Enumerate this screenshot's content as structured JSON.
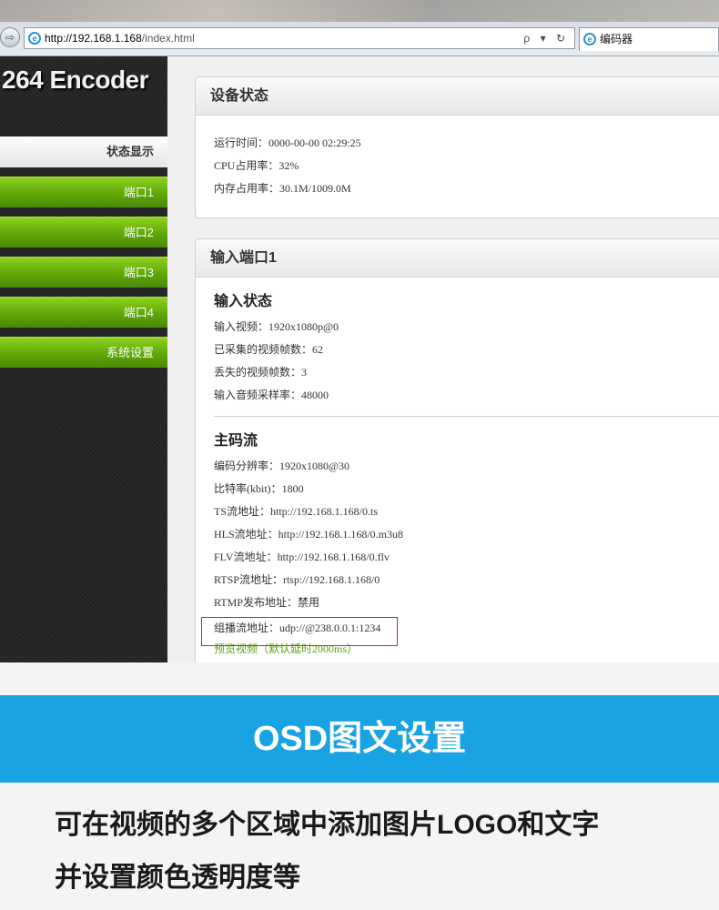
{
  "browser": {
    "url_host": "http://192.168.1.168",
    "url_path": "/index.html",
    "tab_title": "编码器",
    "ie_glyph": "e",
    "back_glyph": "⇨",
    "controls": "ρ ▾ ↻"
  },
  "sidebar": {
    "logo": "264 Encoder",
    "status_label": "状态显示",
    "items": [
      {
        "label": "端口1"
      },
      {
        "label": "端口2"
      },
      {
        "label": "端口3"
      },
      {
        "label": "端口4"
      },
      {
        "label": "系统设置"
      }
    ]
  },
  "device_status": {
    "title": "设备状态",
    "rows": [
      "运行时间：0000-00-00 02:29:25",
      "CPU占用率：32%",
      "内存占用率：30.1M/1009.0M"
    ]
  },
  "input_port": {
    "title": "输入端口1",
    "status_title": "输入状态",
    "status_rows": [
      "输入视频：1920x1080p@0",
      "已采集的视频帧数：62",
      "丢失的视频帧数：3",
      "输入音频采样率：48000"
    ],
    "stream_title": "主码流",
    "stream_rows": [
      "编码分辨率：1920x1080@30",
      "比特率(kbit)：1800",
      "TS流地址：http://192.168.1.168/0.ts",
      "HLS流地址：http://192.168.1.168/0.m3u8",
      "FLV流地址：http://192.168.1.168/0.flv",
      "RTSP流地址：rtsp://192.168.1.168/0",
      "RTMP发布地址：禁用",
      "组播流地址：udp://@238.0.0.1:1234"
    ],
    "preview_link": "预览视频（默认延时2000ms）"
  },
  "banner": {
    "title": "OSD图文设置",
    "bg_color": "#1aa3e2"
  },
  "description": {
    "line1": "可在视频的多个区域中添加图片LOGO和文字",
    "line2": "并设置颜色透明度等"
  },
  "icons": {
    "browser_icon": "ie-icon",
    "back_icon": "back-arrow-icon"
  }
}
